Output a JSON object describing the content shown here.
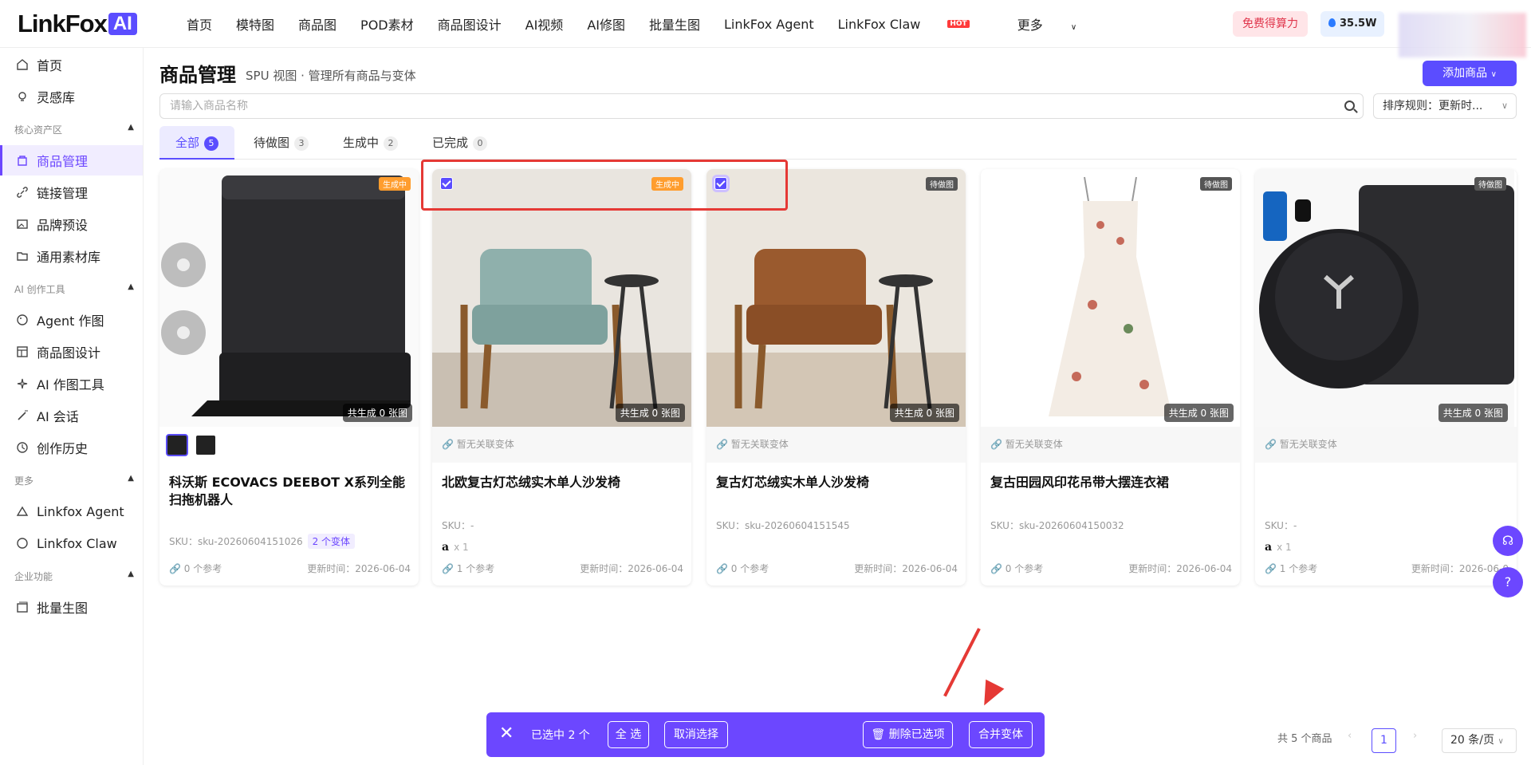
{
  "header": {
    "logo_text": "LinkFox",
    "logo_badge": "AI",
    "nav": [
      "首页",
      "模特图",
      "商品图",
      "POD素材",
      "商品图设计",
      "AI视频",
      "AI修图",
      "批量生图",
      "LinkFox Agent",
      "LinkFox Claw",
      "更多"
    ],
    "hot_badge": "HOT",
    "free_btn": "免费得算力",
    "credit": "35.5W"
  },
  "sidebar": {
    "top_items": [
      "首页",
      "灵感库"
    ],
    "sections": [
      {
        "title": "核心资产区",
        "items": [
          "商品管理",
          "链接管理",
          "品牌预设",
          "通用素材库"
        ]
      },
      {
        "title": "AI 创作工具",
        "items": [
          "Agent 作图",
          "商品图设计",
          "AI 作图工具",
          "AI 会话",
          "创作历史"
        ]
      },
      {
        "title": "更多",
        "items": [
          "Linkfox Agent",
          "Linkfox Claw"
        ]
      },
      {
        "title": "企业功能",
        "items": [
          "批量生图"
        ]
      }
    ],
    "active": "商品管理"
  },
  "page": {
    "title": "商品管理",
    "subtitle": "SPU 视图 · 管理所有商品与变体",
    "add_btn": "添加商品",
    "search_placeholder": "请输入商品名称",
    "sort_label": "排序规则：更新时...",
    "tabs": [
      {
        "label": "全部",
        "count": "5"
      },
      {
        "label": "待做图",
        "count": "3"
      },
      {
        "label": "生成中",
        "count": "2"
      },
      {
        "label": "已完成",
        "count": "0"
      }
    ]
  },
  "cards": [
    {
      "status": "生成中",
      "generated": "共生成 0 张图",
      "variant_text": "",
      "name": "科沃斯 ECOVACS DEEBOT X系列全能扫拖机器人",
      "sku": "SKU：sku-20260604151026",
      "variants_badge": "2 个变体",
      "amazon": "",
      "refs": "0 个参考",
      "time": "更新时间：2026-06-04"
    },
    {
      "status": "生成中",
      "generated": "共生成 0 张图",
      "variant_text": "暂无关联变体",
      "name": "北欧复古灯芯绒实木单人沙发椅",
      "sku": "SKU：-",
      "variants_badge": "",
      "amazon": "x 1",
      "refs": "1 个参考",
      "time": "更新时间：2026-06-04"
    },
    {
      "status": "待做图",
      "generated": "共生成 0 张图",
      "variant_text": "暂无关联变体",
      "name": "复古灯芯绒实木单人沙发椅",
      "sku": "SKU：sku-20260604151545",
      "variants_badge": "",
      "amazon": "",
      "refs": "0 个参考",
      "time": "更新时间：2026-06-04"
    },
    {
      "status": "待做图",
      "generated": "共生成 0 张图",
      "variant_text": "暂无关联变体",
      "name": "复古田园风印花吊带大摆连衣裙",
      "sku": "SKU：sku-20260604150032",
      "variants_badge": "",
      "amazon": "",
      "refs": "0 个参考",
      "time": "更新时间：2026-06-04"
    },
    {
      "status": "待做图",
      "generated": "共生成 0 张图",
      "variant_text": "暂无关联变体",
      "name": "",
      "sku": "SKU：-",
      "variants_badge": "",
      "amazon": "x 1",
      "refs": "1 个参考",
      "time": "更新时间：2026-06-0"
    }
  ],
  "bulk": {
    "selected": "已选中 2 个",
    "select_all": "全 选",
    "cancel": "取消选择",
    "delete": "删除已选项",
    "merge": "合并变体"
  },
  "pagination": {
    "total": "共 5 个商品",
    "current": "1",
    "page_size": "20 条/页"
  },
  "colors": {
    "accent": "#5b4dff",
    "highlight": "#e53935"
  }
}
